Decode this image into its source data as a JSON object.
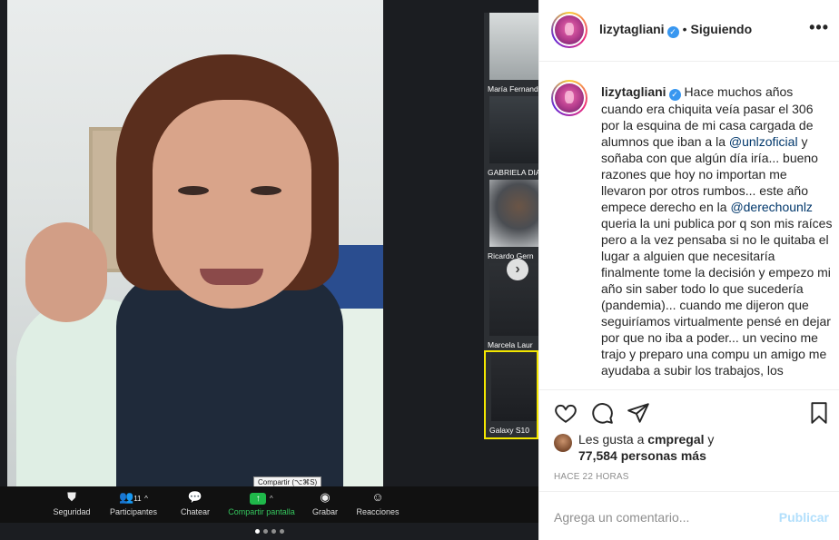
{
  "zoom": {
    "participants_thumbs": [
      {
        "name": "María Fernand"
      },
      {
        "name": "GABRIELA DIA"
      },
      {
        "name": "Ricardo Gern"
      },
      {
        "name": "Marcela Laur"
      },
      {
        "name": "Galaxy S10"
      }
    ],
    "tooltip": "Compartir (⌥⌘S)",
    "toolbar": {
      "security": "Seguridad",
      "participants": "Participantes",
      "participants_count": "11",
      "chat": "Chatear",
      "share": "Compartir pantalla",
      "record": "Grabar",
      "reactions": "Reacciones"
    }
  },
  "post": {
    "username": "lizytagliani",
    "follow_status": "Siguiendo",
    "caption": {
      "part1": "Hace muchos años cuando era chiquita veía pasar el 306 por la esquina de mi casa cargada de alumnos que iban a la ",
      "mention1": "@unlzoficial",
      "part2": " y soñaba con que algún día iría... bueno razones que hoy no importan me llevaron por otros rumbos... este año empece derecho en la ",
      "mention2": "@derechounlz",
      "part3": " queria la uni publica por q son mis raíces pero a la vez pensaba si no le quitaba el lugar a alguien que necesitaría finalmente tome la decisión y empezo mi año sin saber todo lo que sucedería (pandemia)... cuando me dijeron que seguiríamos virtualmente pensé en dejar por que no iba a poder... un vecino me trajo y preparo una compu un amigo me ayudaba a subir los trabajos, los"
    },
    "likes": {
      "prefix": "Les gusta a ",
      "user": "cmpregal",
      "middle": " y ",
      "others": "77,584 personas más"
    },
    "time_ago": "HACE 22 HORAS",
    "comment_placeholder": "Agrega un comentario...",
    "publish_label": "Publicar"
  },
  "colors": {
    "verified": "#3897f0",
    "mention": "#00376b",
    "publish_disabled": "#b2dffc",
    "zoom_share_green": "#35c45d"
  }
}
